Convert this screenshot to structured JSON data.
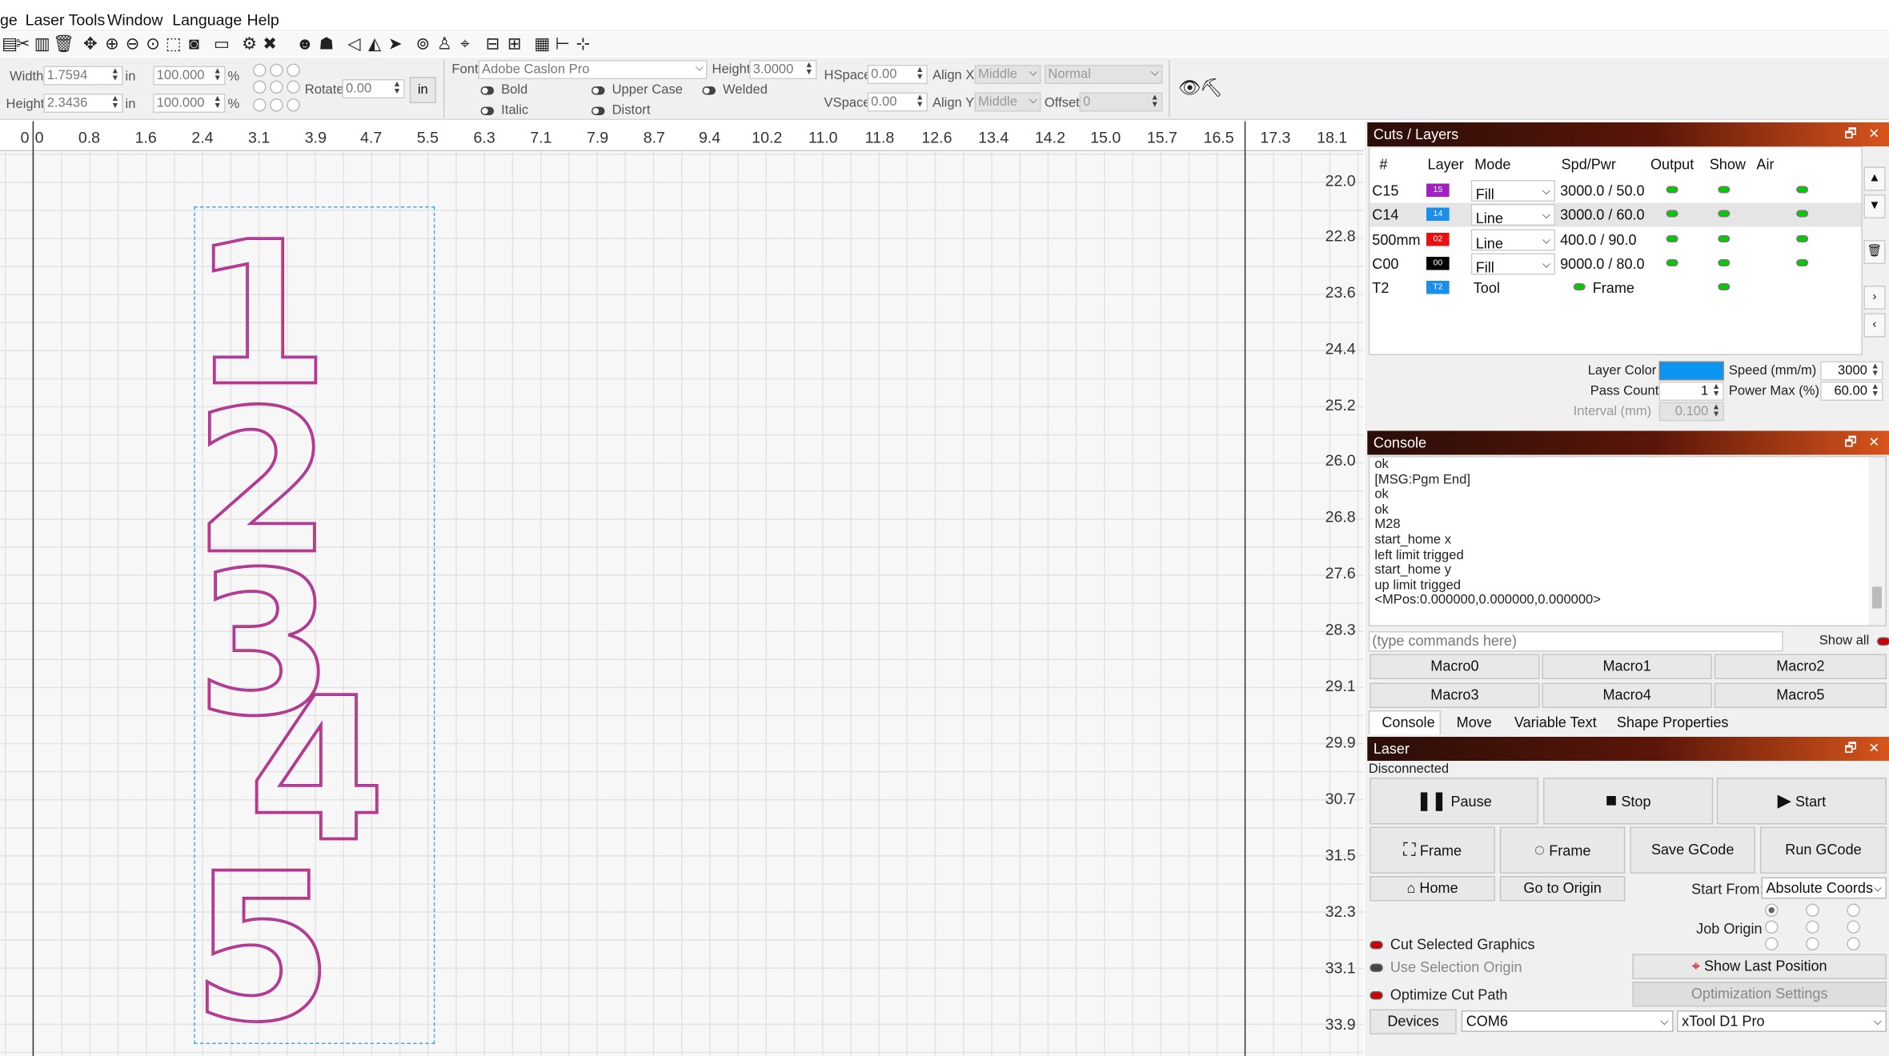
{
  "menu": {
    "item0": "ge",
    "item1": "Laser Tools",
    "item2": "Window",
    "item3": "Language",
    "item4": "Help"
  },
  "props": {
    "width_label": "Width",
    "width_value": "1.7594",
    "width_unit": "in",
    "width_pct": "100.000",
    "pct1": "%",
    "height_label": "Height",
    "height_value": "2.3436",
    "height_unit": "in",
    "height_pct": "100.000",
    "pct2": "%",
    "rotate_label": "Rotate",
    "rotate_value": "0.00",
    "unit_button": "in",
    "font_label": "Font",
    "font_value": "Adobe Caslon Pro",
    "fheight_label": "Height",
    "fheight_value": "3.0000",
    "bold": "Bold",
    "italic": "Italic",
    "upper": "Upper Case",
    "distort": "Distort",
    "welded": "Welded",
    "hspace_label": "HSpace",
    "hspace_value": "0.00",
    "vspace_label": "VSpace",
    "vspace_value": "0.00",
    "alignx_label": "Align X",
    "alignx_value": "Middle",
    "aligny_label": "Align Y",
    "aligny_value": "Middle",
    "normal_value": "Normal",
    "offset_label": "Offset",
    "offset_value": "0"
  },
  "ruler_top": [
    "0",
    "0",
    "0.8",
    "1.6",
    "2.4",
    "3.1",
    "3.9",
    "4.7",
    "5.5",
    "6.3",
    "7.1",
    "7.9",
    "8.7",
    "9.4",
    "10.2",
    "11.0",
    "11.8",
    "12.6",
    "13.4",
    "14.2",
    "15.0",
    "15.7",
    "16.5",
    "17.3",
    "18.1"
  ],
  "ruler_side": [
    "22.0",
    "22.8",
    "23.6",
    "24.4",
    "25.2",
    "26.0",
    "26.8",
    "27.6",
    "28.3",
    "29.1",
    "29.9",
    "30.7",
    "31.5",
    "32.3",
    "33.1",
    "33.9"
  ],
  "artwork_digits": [
    "1",
    "2",
    "3",
    "4",
    "5"
  ],
  "layers_panel": {
    "title": "Cuts / Layers",
    "headers": [
      "#",
      "Layer",
      "Mode",
      "Spd/Pwr",
      "Output",
      "Show",
      "Air"
    ],
    "rows": [
      {
        "name": "C15",
        "num": "15",
        "color": "#a020c0",
        "mode": "Fill",
        "spd": "3000.0 / 50.0"
      },
      {
        "name": "C14",
        "num": "14",
        "color": "#1a8ee8",
        "mode": "Line",
        "spd": "3000.0 / 60.0"
      },
      {
        "name": "500mm",
        "num": "02",
        "color": "#e81010",
        "mode": "Line",
        "spd": "400.0 / 90.0"
      },
      {
        "name": "C00",
        "num": "00",
        "color": "#000000",
        "mode": "Fill",
        "spd": "9000.0 / 80.0"
      },
      {
        "name": "T2",
        "num": "T2",
        "color": "#1a8ee8",
        "mode": "Tool",
        "spd": "Frame"
      }
    ],
    "layer_color_label": "Layer Color",
    "layer_color": "#0a96f0",
    "speed_label": "Speed (mm/m)",
    "speed_value": "3000",
    "pass_label": "Pass Count",
    "pass_value": "1",
    "power_label": "Power Max (%)",
    "power_value": "60.00",
    "interval_label": "Interval (mm)",
    "interval_value": "0.100"
  },
  "console_panel": {
    "title": "Console",
    "lines": [
      "ok",
      "[MSG:Pgm End]",
      "ok",
      "ok",
      "M28",
      "start_home x",
      "left limit trigged",
      "start_home y",
      "up limit trigged",
      "<MPos:0.000000,0.000000,0.000000>"
    ],
    "placeholder": "(type commands here)",
    "show_all": "Show all",
    "macros": [
      "Macro0",
      "Macro1",
      "Macro2",
      "Macro3",
      "Macro4",
      "Macro5"
    ],
    "tabs": [
      "Console",
      "Move",
      "Variable Text",
      "Shape Properties"
    ]
  },
  "laser_panel": {
    "title": "Laser",
    "status": "Disconnected",
    "pause": "Pause",
    "stop": "Stop",
    "start": "Start",
    "frame1": "Frame",
    "frame2": "Frame",
    "save_gcode": "Save GCode",
    "run_gcode": "Run GCode",
    "home": "Home",
    "go_origin": "Go to Origin",
    "start_from_label": "Start From:",
    "start_from_value": "Absolute Coords",
    "job_origin": "Job Origin",
    "cut_selected": "Cut Selected Graphics",
    "use_selection": "Use Selection Origin",
    "optimize": "Optimize Cut Path",
    "show_last": "Show Last Position",
    "opt_settings": "Optimization Settings",
    "devices": "Devices",
    "port": "COM6",
    "machine": "xTool D1 Pro"
  }
}
